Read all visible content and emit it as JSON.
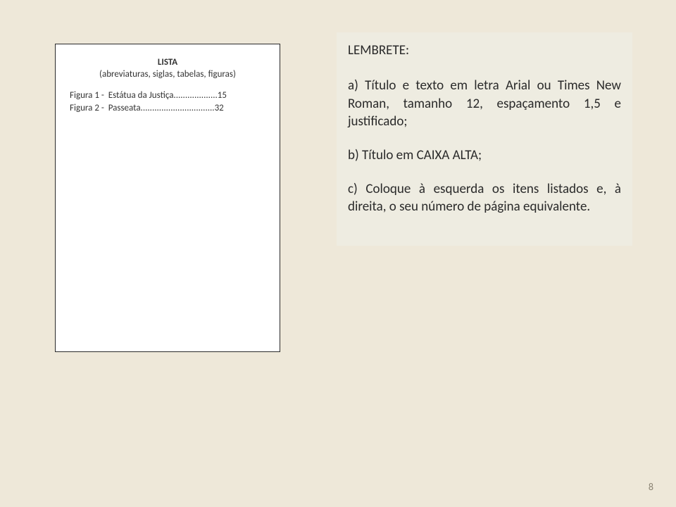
{
  "left": {
    "title": "LISTA",
    "subtitle": "(abreviaturas, siglas, tabelas, figuras)",
    "lines": [
      "Figura 1 -  Estátua da Justiça...................15",
      "Figura 2 -  Passeata................................32"
    ]
  },
  "right": {
    "title": "LEMBRETE:",
    "paragraphs": [
      "a) Título e texto em letra Arial ou Times New Roman, tamanho 12, espaçamento 1,5 e justificado;",
      "b) Título em CAIXA ALTA;",
      "c) Coloque à esquerda os itens listados e, à direita, o seu número de página equivalente."
    ]
  },
  "page_number": "8"
}
